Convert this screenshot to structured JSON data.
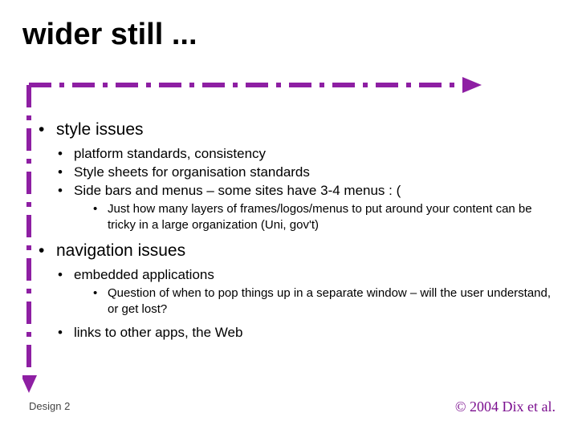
{
  "title": "wider still ...",
  "bullets": {
    "l1_1": "style issues",
    "l2_1": "platform standards, consistency",
    "l2_2": "Style sheets for organisation standards",
    "l2_3": "Side bars and menus – some sites have 3-4 menus : (",
    "l3_1": "Just how many layers of frames/logos/menus to put around your content can be tricky in a large organization (Uni, gov't)",
    "l1_2": "navigation issues",
    "l2_4": "embedded applications",
    "l3_2": "Question of when to pop things up in a separate window – will the user understand, or get lost?",
    "l2_5": "links to other apps, the Web"
  },
  "footer": {
    "left": "Design 2",
    "right": "© 2004 Dix et al."
  },
  "colors": {
    "accent": "#8e1fa3"
  }
}
